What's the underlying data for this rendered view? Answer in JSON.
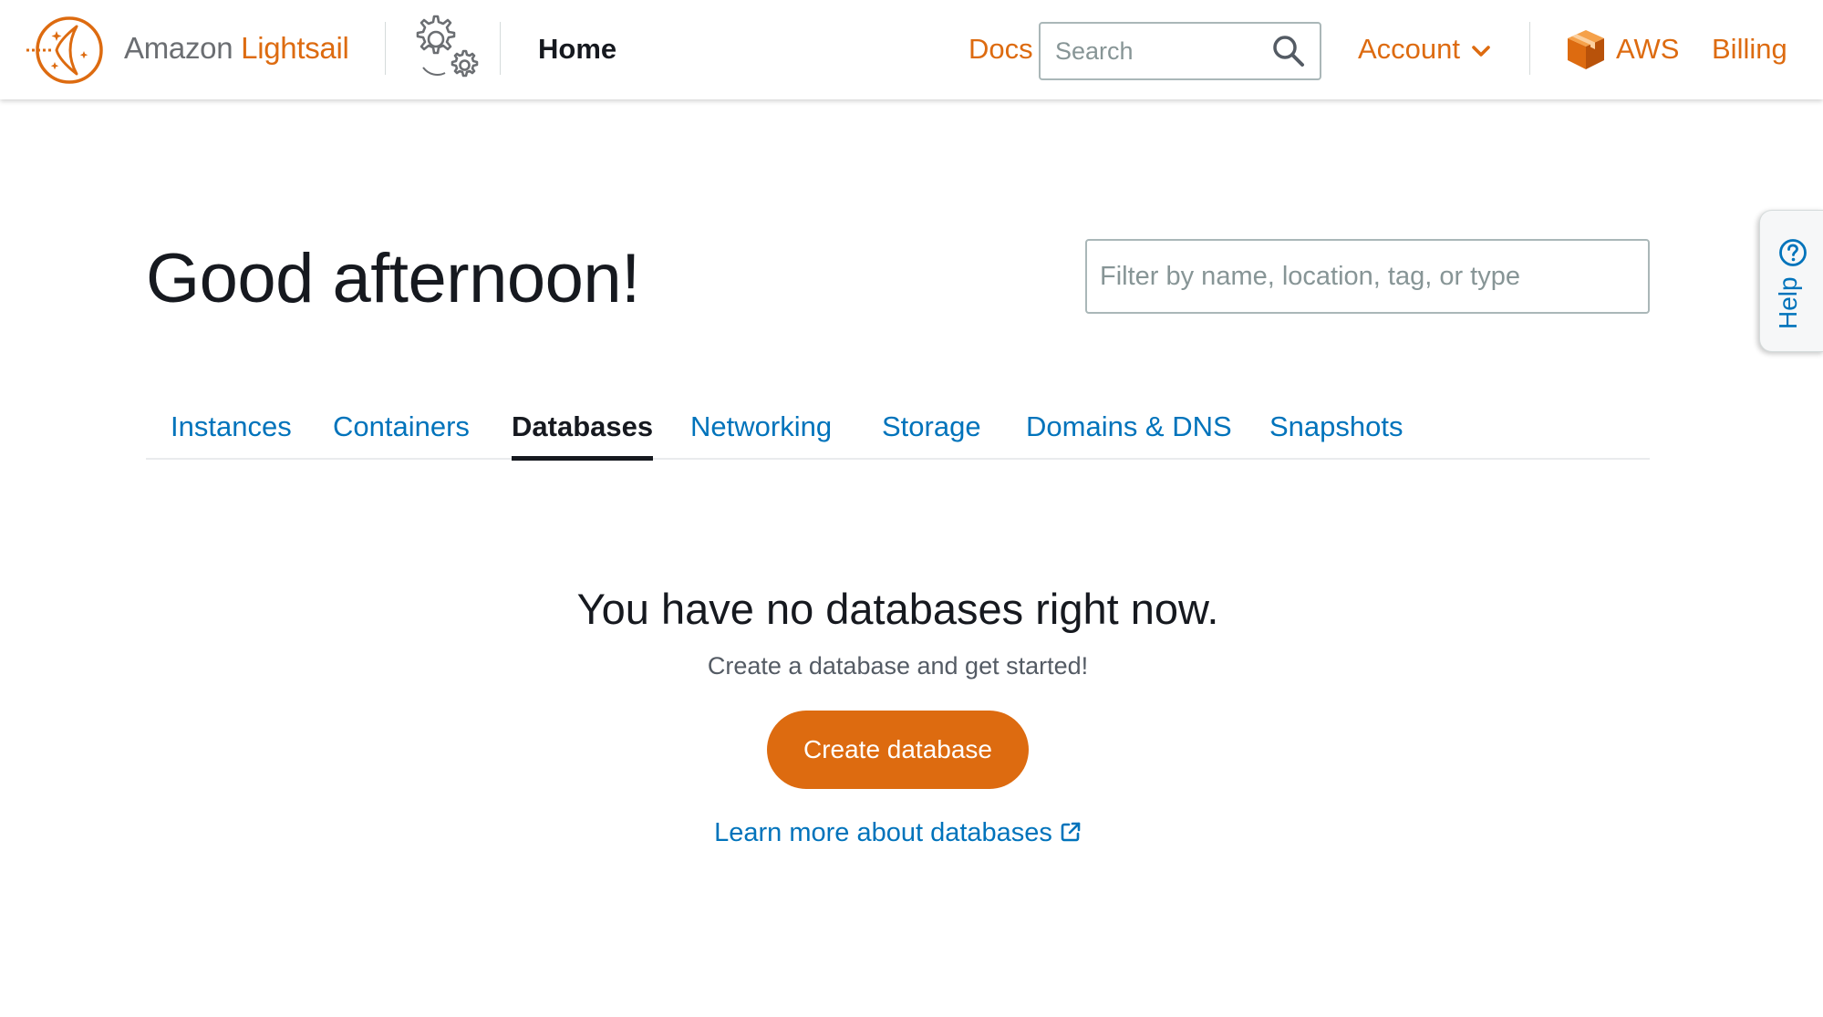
{
  "header": {
    "brand_amazon": "Amazon",
    "brand_lightsail": "Lightsail",
    "page_title": "Home",
    "docs_label": "Docs",
    "search_placeholder": "Search",
    "account_label": "Account",
    "aws_label": "AWS",
    "billing_label": "Billing"
  },
  "help": {
    "label": "Help"
  },
  "main": {
    "greeting": "Good afternoon!",
    "filter_placeholder": "Filter by name, location, tag, or type",
    "tabs": [
      {
        "label": "Instances",
        "active": false
      },
      {
        "label": "Containers",
        "active": false
      },
      {
        "label": "Databases",
        "active": true
      },
      {
        "label": "Networking",
        "active": false
      },
      {
        "label": "Storage",
        "active": false
      },
      {
        "label": "Domains & DNS",
        "active": false
      },
      {
        "label": "Snapshots",
        "active": false
      }
    ],
    "empty_state": {
      "title": "You have no databases right now.",
      "subtitle": "Create a database and get started!",
      "create_button": "Create database",
      "learn_more": "Learn more about databases"
    }
  },
  "colors": {
    "brand_orange": "#dd6b10",
    "link_blue": "#0073bb",
    "text_dark": "#16191f"
  },
  "icons": [
    "lightsail-logo-icon",
    "settings-gears-icon",
    "search-icon",
    "chevron-down-icon",
    "aws-cube-icon",
    "help-question-icon",
    "external-link-icon"
  ]
}
